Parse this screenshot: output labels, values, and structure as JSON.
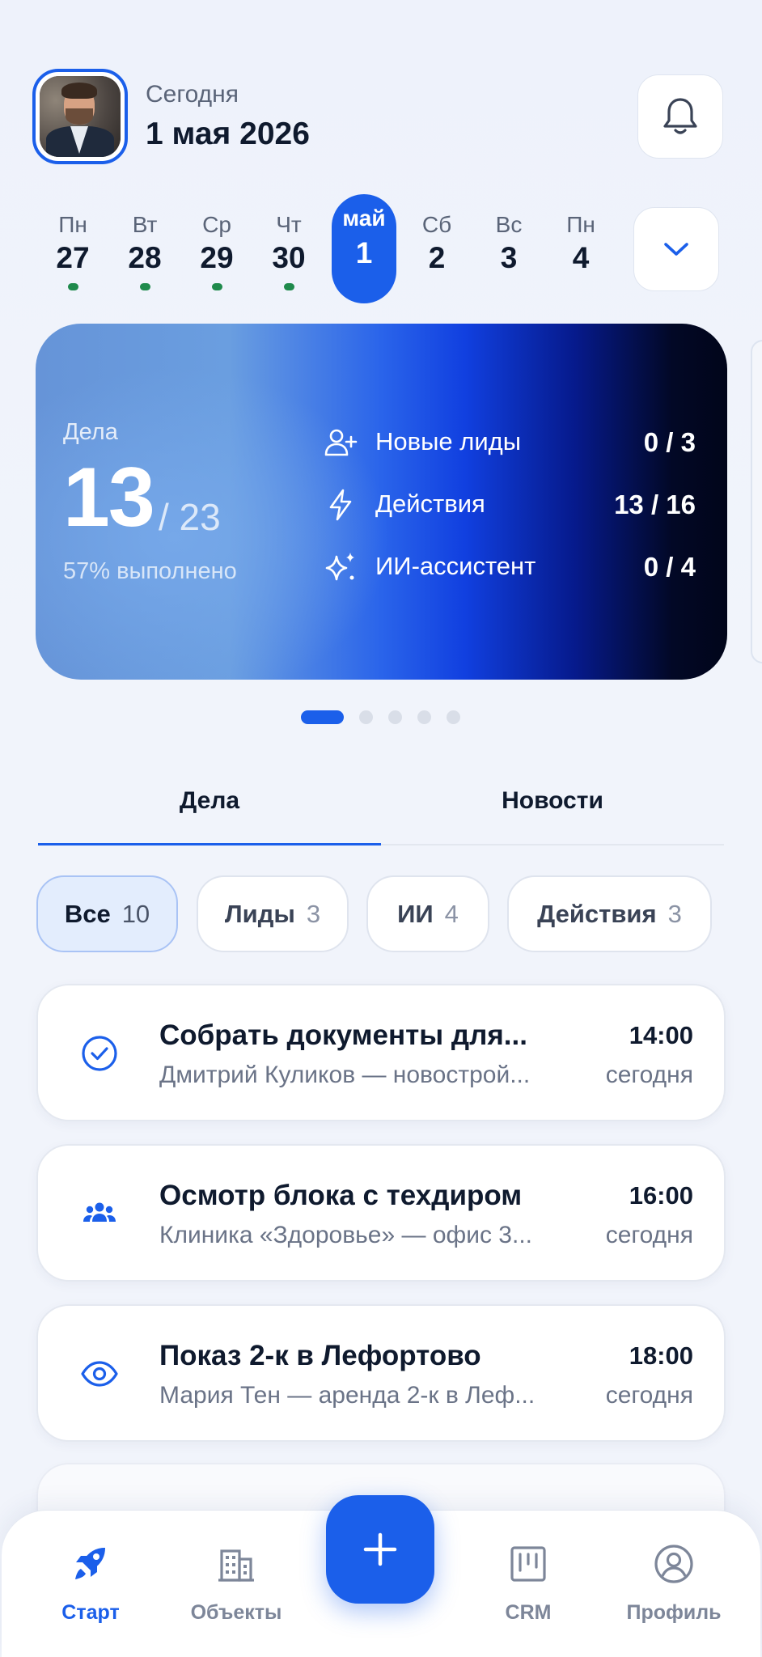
{
  "header": {
    "date_label": "Сегодня",
    "date_value": "1 мая 2026",
    "bell_icon": "bell-icon"
  },
  "week": {
    "days": [
      {
        "name": "Пн",
        "num": "27",
        "has_tasks": true,
        "active": false
      },
      {
        "name": "Вт",
        "num": "28",
        "has_tasks": true,
        "active": false
      },
      {
        "name": "Ср",
        "num": "29",
        "has_tasks": true,
        "active": false
      },
      {
        "name": "Чт",
        "num": "30",
        "has_tasks": true,
        "active": false
      },
      {
        "name": "май",
        "num": "1",
        "has_tasks": false,
        "active": true
      },
      {
        "name": "Сб",
        "num": "2",
        "has_tasks": false,
        "active": false
      },
      {
        "name": "Вс",
        "num": "3",
        "has_tasks": false,
        "active": false
      },
      {
        "name": "Пн",
        "num": "4",
        "has_tasks": false,
        "active": false
      }
    ],
    "expand_icon": "chevron-down-icon"
  },
  "stats": {
    "label": "Дела",
    "done": "13",
    "total": "/ 23",
    "percent_text": "57% выполнено",
    "rows": [
      {
        "icon": "user-plus-icon",
        "label": "Новые лиды",
        "value": "0 / 3"
      },
      {
        "icon": "lightning-icon",
        "label": "Действия",
        "value": "13 / 16"
      },
      {
        "icon": "sparkles-icon",
        "label": "ИИ-ассистент",
        "value": "0 / 4"
      }
    ],
    "pager": {
      "count": 5,
      "active": 0
    }
  },
  "tabs": {
    "items": [
      "Дела",
      "Новости"
    ],
    "active": 0
  },
  "filters": [
    {
      "label": "Все",
      "count": "10",
      "active": true
    },
    {
      "label": "Лиды",
      "count": "3",
      "active": false
    },
    {
      "label": "ИИ",
      "count": "4",
      "active": false
    },
    {
      "label": "Действия",
      "count": "3",
      "active": false
    }
  ],
  "tasks": [
    {
      "icon": "check-circle-icon",
      "title": "Собрать документы для...",
      "subtitle": "Дмитрий Куликов — новострой...",
      "time": "14:00",
      "day": "сегодня"
    },
    {
      "icon": "group-icon",
      "title": "Осмотр блока с техдиром",
      "subtitle": "Клиника «Здоровье» — офис 3...",
      "time": "16:00",
      "day": "сегодня"
    },
    {
      "icon": "eye-icon",
      "title": "Показ 2-к в Лефортово",
      "subtitle": "Мария Тен — аренда 2-к в Леф...",
      "time": "18:00",
      "day": "сегодня"
    }
  ],
  "nav": {
    "items": [
      {
        "icon": "rocket-icon",
        "label": "Старт",
        "active": true
      },
      {
        "icon": "building-icon",
        "label": "Объекты",
        "active": false
      },
      {
        "icon": "kanban-icon",
        "label": "CRM",
        "active": false
      },
      {
        "icon": "user-circle-icon",
        "label": "Профиль",
        "active": false
      }
    ],
    "fab_icon": "plus-icon"
  },
  "colors": {
    "accent": "#1b5fea",
    "dot_green": "#1f8a4c",
    "text_primary": "#0f1a2e",
    "text_secondary": "#6a7387"
  }
}
